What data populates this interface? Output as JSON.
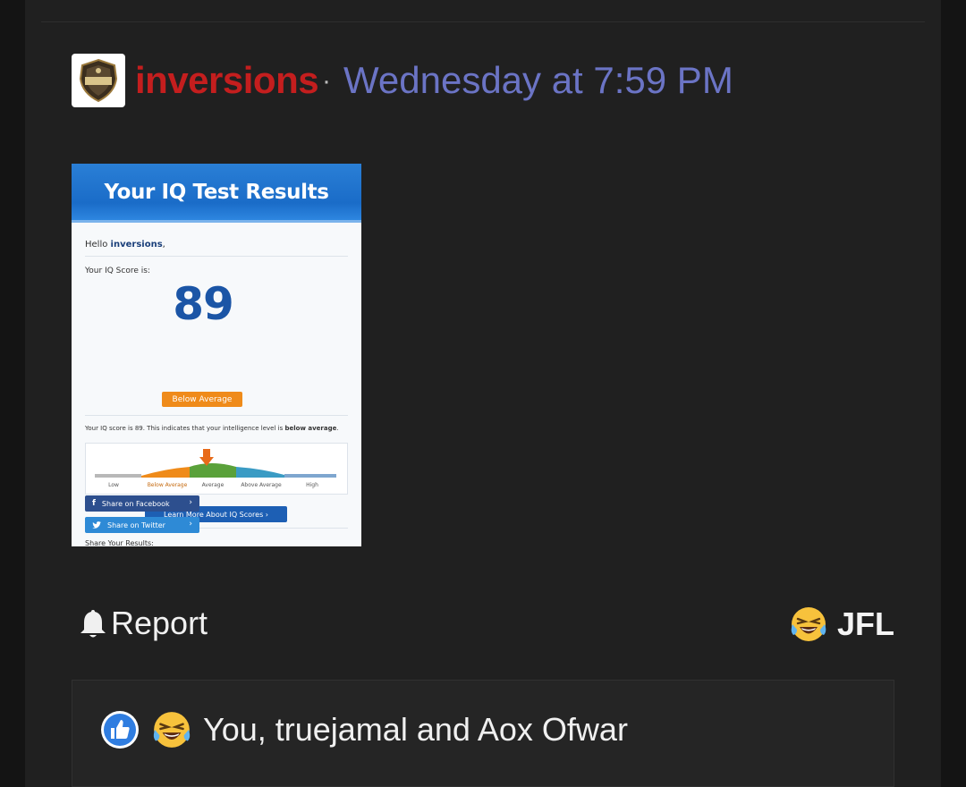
{
  "post": {
    "author": "inversions",
    "separator": "·",
    "timestamp": "Wednesday at 7:59 PM",
    "colors": {
      "author": "#c41e1e",
      "timestamp": "#6b74c5",
      "background": "#202020"
    }
  },
  "attachment": {
    "title": "Your IQ Test Results",
    "greeting": "Hello",
    "greeting_name": "inversions",
    "greeting_suffix": ",",
    "score_label": "Your IQ Score is:",
    "score": "89",
    "rating": "Below Average",
    "verdict_prefix": "Your IQ score is 89. This indicates that your intelligence level is",
    "verdict_emphasis": "below average",
    "verdict_suffix": ".",
    "scale": [
      {
        "label": "Low",
        "color": "#b8b8b8"
      },
      {
        "label": "Below Average",
        "color": "#ef8b1a"
      },
      {
        "label": "Average",
        "color": "#5aa13a"
      },
      {
        "label": "Above Average",
        "color": "#3a9bc4"
      },
      {
        "label": "High",
        "color": "#7ea6cf"
      }
    ],
    "learn_more": "Learn More About IQ Scores ›",
    "share_label": "Share Your Results:",
    "share_facebook": "Share on Facebook",
    "share_twitter": "Share on Twitter",
    "chevron": "›"
  },
  "actions": {
    "report_label": "Report",
    "reaction_label": "JFL"
  },
  "reactions": {
    "summary": "You, truejamal and Aox Ofwar"
  }
}
